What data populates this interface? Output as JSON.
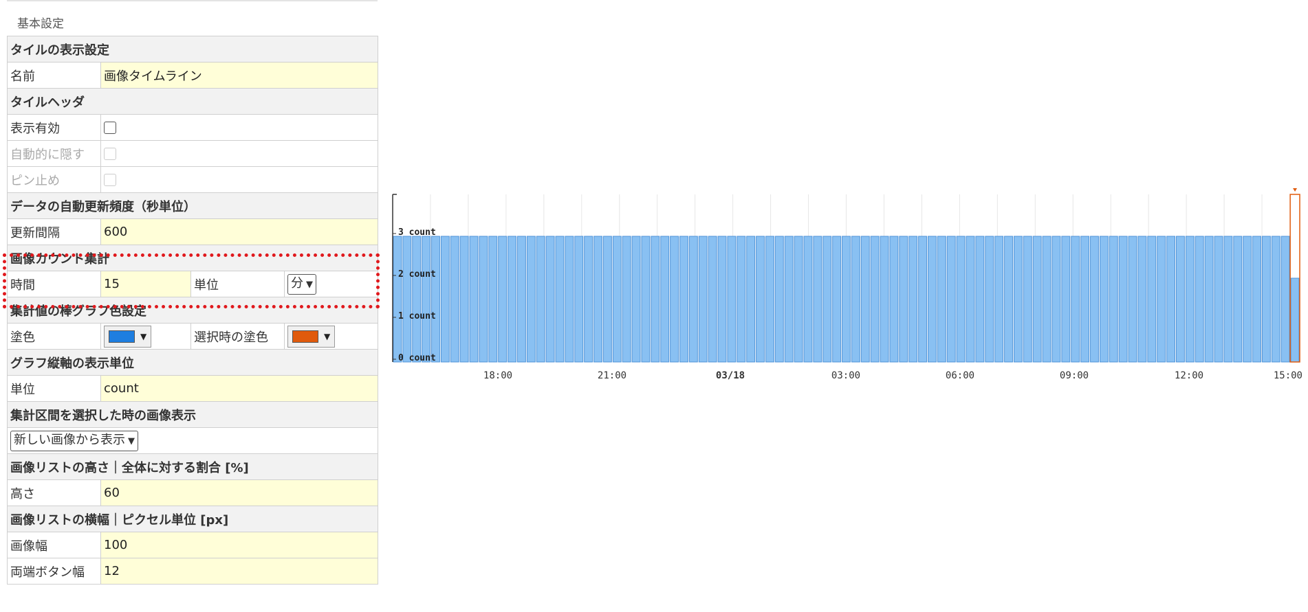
{
  "section_title": "基本設定",
  "rows": {
    "tile_display": "タイルの表示設定",
    "name_label": "名前",
    "name_value": "画像タイムライン",
    "tile_header": "タイルヘッダ",
    "display_enabled": "表示有効",
    "auto_hide": "自動的に隠す",
    "pin": "ピン止め",
    "refresh_header": "データの自動更新頻度（秒単位）",
    "refresh_label": "更新間隔",
    "refresh_value": "600",
    "count_header": "画像カウント集計",
    "time_label": "時間",
    "time_value": "15",
    "unit_label": "単位",
    "unit_select": "分",
    "bar_color_header": "集計値の棒グラフ色設定",
    "fill_label": "塗色",
    "selected_fill_label": "選択時の塗色",
    "axis_unit_header": "グラフ縦軸の表示単位",
    "axis_unit_label": "単位",
    "axis_unit_value": "count",
    "range_select_header": "集計区間を選択した時の画像表示",
    "order_select": "新しい画像から表示",
    "list_height_header": "画像リストの高さ｜全体に対する割合 [%]",
    "height_label": "高さ",
    "height_value": "60",
    "list_width_header": "画像リストの横幅｜ピクセル単位 [px]",
    "image_width_label": "画像幅",
    "image_width_value": "100",
    "button_width_label": "両端ボタン幅",
    "button_width_value": "12"
  },
  "colors": {
    "fill": "#1e7ee0",
    "selected_fill": "#e05a0c",
    "bar": "#89c0f2",
    "bar_stroke": "#4f93d8",
    "highlight": "#e0191d"
  },
  "chart_data": {
    "type": "bar",
    "unit": "count",
    "y_ticks": [
      "0 count",
      "1 count",
      "2 count",
      "3 count"
    ],
    "ylim": [
      0,
      4
    ],
    "x_ticks": [
      "18:00",
      "21:00",
      "03/18",
      "03:00",
      "06:00",
      "09:00",
      "12:00",
      "15:00"
    ],
    "x_ticks_bold": [
      "03/18"
    ],
    "interval": "15分",
    "bar_count": 95,
    "values_note_free": true,
    "values": [
      3,
      3,
      3,
      3,
      3,
      3,
      3,
      3,
      3,
      3,
      3,
      3,
      3,
      3,
      3,
      3,
      3,
      3,
      3,
      3,
      3,
      3,
      3,
      3,
      3,
      3,
      3,
      3,
      3,
      3,
      3,
      3,
      3,
      3,
      3,
      3,
      3,
      3,
      3,
      3,
      3,
      3,
      3,
      3,
      3,
      3,
      3,
      3,
      3,
      3,
      3,
      3,
      3,
      3,
      3,
      3,
      3,
      3,
      3,
      3,
      3,
      3,
      3,
      3,
      3,
      3,
      3,
      3,
      3,
      3,
      3,
      3,
      3,
      3,
      3,
      3,
      3,
      3,
      3,
      3,
      3,
      3,
      3,
      3,
      3,
      3,
      3,
      3,
      3,
      3,
      3,
      3,
      3,
      3,
      2
    ],
    "selected_last": true
  }
}
